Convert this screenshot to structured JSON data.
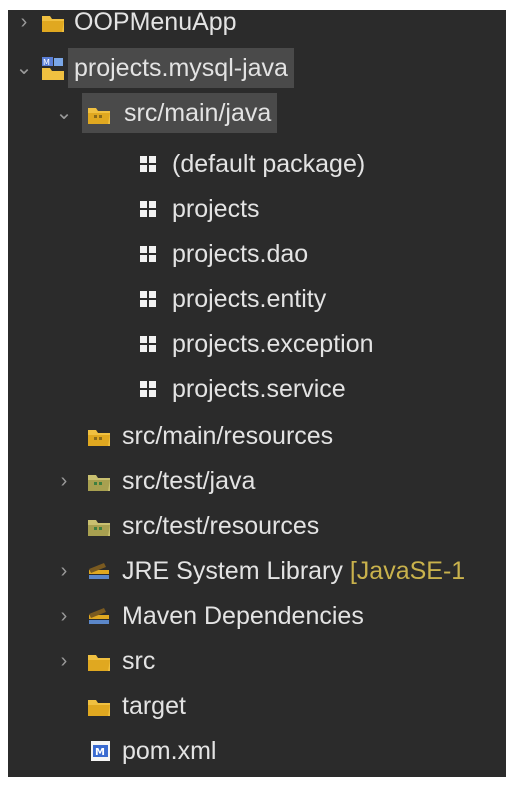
{
  "tree": {
    "root_prev": {
      "label": "OOPMenuApp"
    },
    "project": {
      "label": "projects.mysql-java"
    },
    "src_main_java": {
      "label": "src/main/java"
    },
    "packages": [
      {
        "label": "(default package)"
      },
      {
        "label": "projects"
      },
      {
        "label": "projects.dao"
      },
      {
        "label": "projects.entity"
      },
      {
        "label": "projects.exception"
      },
      {
        "label": "projects.service"
      }
    ],
    "src_main_resources": {
      "label": "src/main/resources"
    },
    "src_test_java": {
      "label": "src/test/java"
    },
    "src_test_resources": {
      "label": "src/test/resources"
    },
    "jre": {
      "label": "JRE System Library",
      "decoration": "[JavaSE-1"
    },
    "maven": {
      "label": "Maven Dependencies"
    },
    "src": {
      "label": "src"
    },
    "target": {
      "label": "target"
    },
    "pom": {
      "label": "pom.xml"
    }
  },
  "icons": {
    "expanded": "chevron-down-icon",
    "collapsed": "chevron-right-icon"
  },
  "colors": {
    "background": "#2b2b2b",
    "text": "#e3e3e3",
    "selection": "#4a4a4a",
    "decoration": "#c9b24c",
    "folder": "#f0c040"
  }
}
